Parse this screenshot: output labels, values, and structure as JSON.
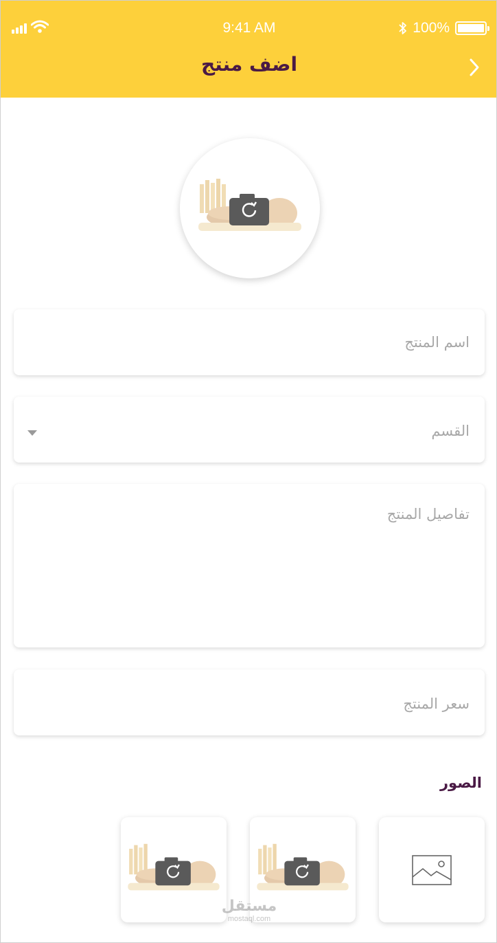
{
  "status_bar": {
    "time": "9:41 AM",
    "battery_text": "100%",
    "signal_icon": "signal-bars-icon",
    "wifi_icon": "wifi-icon",
    "bluetooth_icon": "bluetooth-icon"
  },
  "header": {
    "title": "اضف منتج",
    "back_icon": "chevron-right-icon",
    "background_color": "#fdd03b",
    "title_color": "#4a1a45"
  },
  "product_image": {
    "icon": "camera-icon"
  },
  "form": {
    "name_placeholder": "اسم المنتج",
    "category_placeholder": "القسم",
    "category_icon": "dropdown-caret-icon",
    "details_placeholder": "تفاصيل المنتج",
    "price_placeholder": "سعر المنتج"
  },
  "images_section": {
    "title": "الصور",
    "add_image_icon": "image-placeholder-icon",
    "thumb_icon": "camera-icon"
  },
  "watermark": {
    "arabic": "مستقل",
    "latin": "mostaql.com"
  }
}
